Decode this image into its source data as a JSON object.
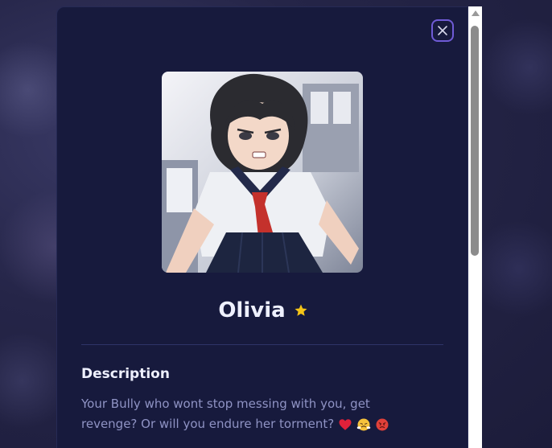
{
  "profile": {
    "name": "Olivia",
    "description_title": "Description",
    "description_text": "Your Bully who wont stop messing with you, get revenge? Or will you endure her torment?"
  },
  "icons": {
    "close": "close-icon",
    "favorite": "star-icon",
    "emojis": [
      "heart-emoji-icon",
      "steam-face-emoji-icon",
      "angry-face-emoji-icon"
    ]
  },
  "colors": {
    "modal_bg": "#171a3d",
    "accent": "#6f5bd6",
    "star": "#f5c518",
    "text_primary": "#eef0ff",
    "text_secondary": "#8f93c4"
  }
}
